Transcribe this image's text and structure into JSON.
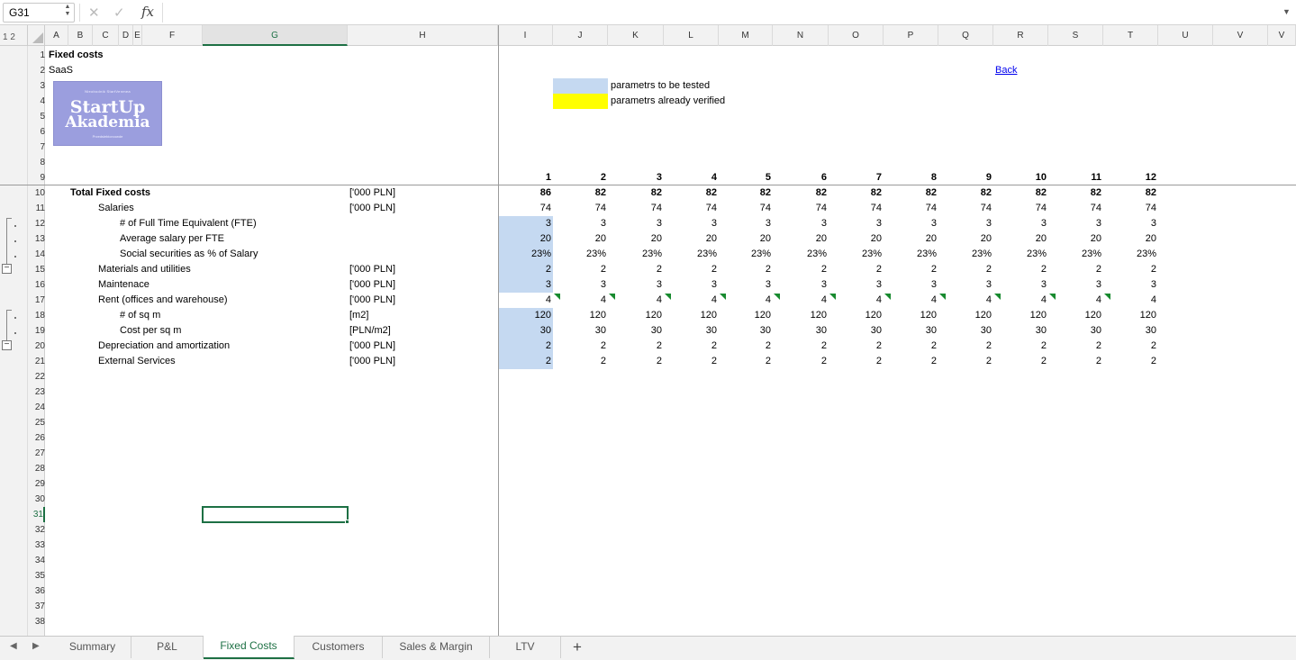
{
  "formula_bar": {
    "name_box": "G31",
    "fx_label": "fx",
    "formula": ""
  },
  "outline_levels": "1 2",
  "columns": [
    "A",
    "B",
    "C",
    "D",
    "E",
    "F",
    "G",
    "H",
    "I",
    "J",
    "K",
    "L",
    "M",
    "N",
    "O",
    "P",
    "Q",
    "R",
    "S",
    "T",
    "U",
    "V",
    "V"
  ],
  "rows": [
    "1",
    "2",
    "3",
    "4",
    "5",
    "6",
    "7",
    "8",
    "9",
    "10",
    "11",
    "12",
    "13",
    "14",
    "15",
    "16",
    "17",
    "18",
    "19",
    "20",
    "21",
    "22",
    "23",
    "24",
    "25",
    "26",
    "27",
    "28",
    "29",
    "30",
    "31",
    "32",
    "33",
    "34",
    "35",
    "36",
    "37",
    "38"
  ],
  "sheet": {
    "title": "Fixed costs",
    "subtitle": "SaaS",
    "back_link": "Back",
    "legend": [
      {
        "label": "parametrs to be tested",
        "color": "#c5d9f1"
      },
      {
        "label": "parametrs already verified",
        "color": "#ffff00"
      }
    ],
    "logo": {
      "top": "Nieobodnik StartVenmea",
      "main": "StartUp",
      "sub": "Akademia",
      "bottom": "Przedsiebiorcowde"
    },
    "periods": [
      "1",
      "2",
      "3",
      "4",
      "5",
      "6",
      "7",
      "8",
      "9",
      "10",
      "11",
      "12"
    ],
    "rows": [
      {
        "label": "Total Fixed costs",
        "unit": "['000 PLN]",
        "values": [
          "86",
          "82",
          "82",
          "82",
          "82",
          "82",
          "82",
          "82",
          "82",
          "82",
          "82",
          "82"
        ]
      },
      {
        "label": "Salaries",
        "unit": "['000 PLN]",
        "values": [
          "74",
          "74",
          "74",
          "74",
          "74",
          "74",
          "74",
          "74",
          "74",
          "74",
          "74",
          "74"
        ]
      },
      {
        "label": "# of Full Time Equivalent (FTE)",
        "unit": "",
        "values": [
          "3",
          "3",
          "3",
          "3",
          "3",
          "3",
          "3",
          "3",
          "3",
          "3",
          "3",
          "3"
        ]
      },
      {
        "label": "Average salary per FTE",
        "unit": "",
        "values": [
          "20",
          "20",
          "20",
          "20",
          "20",
          "20",
          "20",
          "20",
          "20",
          "20",
          "20",
          "20"
        ]
      },
      {
        "label": "Social securities as % of Salary",
        "unit": "",
        "values": [
          "23%",
          "23%",
          "23%",
          "23%",
          "23%",
          "23%",
          "23%",
          "23%",
          "23%",
          "23%",
          "23%",
          "23%"
        ]
      },
      {
        "label": "Materials and utilities",
        "unit": "['000 PLN]",
        "values": [
          "2",
          "2",
          "2",
          "2",
          "2",
          "2",
          "2",
          "2",
          "2",
          "2",
          "2",
          "2"
        ]
      },
      {
        "label": "Maintenace",
        "unit": "['000 PLN]",
        "values": [
          "3",
          "3",
          "3",
          "3",
          "3",
          "3",
          "3",
          "3",
          "3",
          "3",
          "3",
          "3"
        ]
      },
      {
        "label": "Rent (offices and warehouse)",
        "unit": "['000 PLN]",
        "values": [
          "4",
          "4",
          "4",
          "4",
          "4",
          "4",
          "4",
          "4",
          "4",
          "4",
          "4",
          "4"
        ]
      },
      {
        "label": "# of sq m",
        "unit": "[m2]",
        "values": [
          "120",
          "120",
          "120",
          "120",
          "120",
          "120",
          "120",
          "120",
          "120",
          "120",
          "120",
          "120"
        ]
      },
      {
        "label": "Cost per sq m",
        "unit": "[PLN/m2]",
        "values": [
          "30",
          "30",
          "30",
          "30",
          "30",
          "30",
          "30",
          "30",
          "30",
          "30",
          "30",
          "30"
        ]
      },
      {
        "label": "Depreciation and amortization",
        "unit": "['000 PLN]",
        "values": [
          "2",
          "2",
          "2",
          "2",
          "2",
          "2",
          "2",
          "2",
          "2",
          "2",
          "2",
          "2"
        ]
      },
      {
        "label": "External Services",
        "unit": "['000 PLN]",
        "values": [
          "2",
          "2",
          "2",
          "2",
          "2",
          "2",
          "2",
          "2",
          "2",
          "2",
          "2",
          "2"
        ]
      }
    ]
  },
  "tabs": [
    "Summary",
    "P&L",
    "Fixed Costs",
    "Customers",
    "Sales & Margin",
    "LTV"
  ],
  "active_tab": "Fixed Costs",
  "add_sheet": "+",
  "colors": {
    "accent": "#1d7044",
    "param_tested": "#c5d9f1",
    "param_verified": "#ffff00"
  }
}
